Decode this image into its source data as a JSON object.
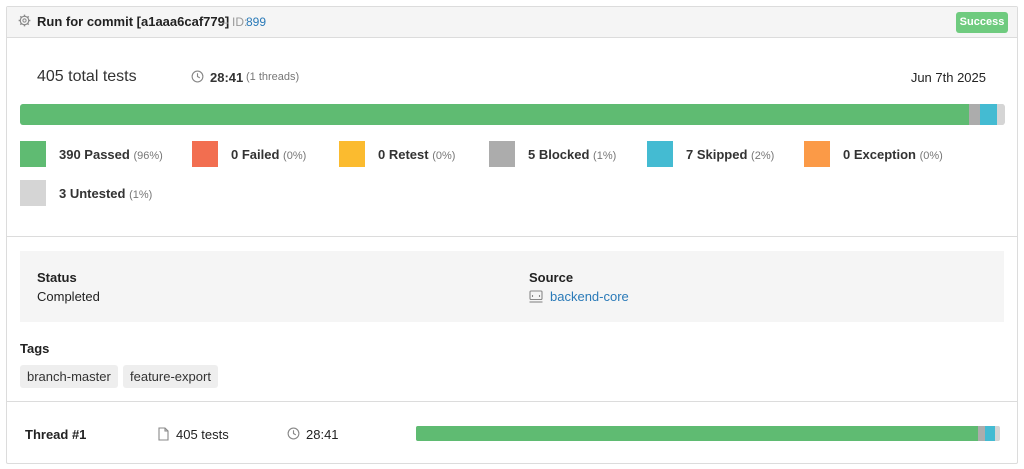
{
  "header": {
    "title": "Run for commit [a1aaa6caf779]",
    "id_prefix": "– ID:",
    "id_value": "899",
    "status_badge": "Success"
  },
  "summary": {
    "total": "405 total tests",
    "duration": "28:41",
    "threads": "(1 threads)",
    "date": "Jun 7th 2025",
    "progress_fractions": {
      "passed": 0.963,
      "failed": 0.0,
      "retest": 0.0,
      "blocked": 0.012,
      "skipped": 0.017,
      "exception": 0.0,
      "untested": 0.007
    }
  },
  "legend": [
    {
      "key": "passed",
      "label": "390 Passed",
      "pct": "(96%)",
      "color": "#5fbb72"
    },
    {
      "key": "failed",
      "label": "0 Failed",
      "pct": "(0%)",
      "color": "#f26e50"
    },
    {
      "key": "retest",
      "label": "0 Retest",
      "pct": "(0%)",
      "color": "#fbbb2f"
    },
    {
      "key": "blocked",
      "label": "5 Blocked",
      "pct": "(1%)",
      "color": "#acacac"
    },
    {
      "key": "skipped",
      "label": "7 Skipped",
      "pct": "(2%)",
      "color": "#44bbd2"
    },
    {
      "key": "exception",
      "label": "0 Exception",
      "pct": "(0%)",
      "color": "#fb9a47"
    },
    {
      "key": "untested",
      "label": "3 Untested",
      "pct": "(1%)",
      "color": "#d5d5d5"
    }
  ],
  "details": {
    "status_label": "Status",
    "status_value": "Completed",
    "source_label": "Source",
    "source_value": "backend-core"
  },
  "tags": {
    "label": "Tags",
    "items": [
      "branch-master",
      "feature-export"
    ]
  },
  "thread": {
    "title": "Thread #1",
    "tests": "405 tests",
    "duration": "28:41"
  },
  "icons": {
    "header": "gear-icon",
    "duration": "clock-icon",
    "source": "repository-icon",
    "thread_tests": "document-icon"
  }
}
